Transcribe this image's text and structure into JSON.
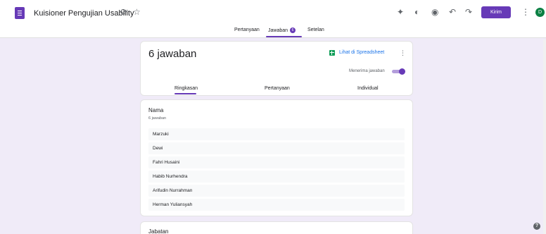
{
  "header": {
    "title": "Kuisioner Pengujian Usability",
    "send_label": "Kirim",
    "avatar_initial": "D"
  },
  "tabs": {
    "questions": "Pertanyaan",
    "responses": "Jawaban",
    "responses_badge": "6",
    "settings": "Setelan"
  },
  "summary": {
    "count_text": "6 jawaban",
    "sheets_link": "Lihat di Spreadsheet",
    "accepting_label": "Menerima jawaban",
    "accepting": true,
    "subtabs": [
      "Ringkasan",
      "Pertanyaan",
      "Individual"
    ]
  },
  "question": {
    "title": "Nama",
    "count_text": "6 jawaban",
    "answers": [
      "Marzuki",
      "Dewi",
      "Fahri Husaini",
      "Habib Nurhendra",
      "Arifudin Nurrahman",
      "Herman Yuliansyah"
    ]
  },
  "next_question": {
    "title": "Jabatan"
  },
  "colors": {
    "accent": "#673ab7",
    "background": "#f0ebf8",
    "link": "#1a73e8",
    "sheets": "#0f9d58"
  }
}
